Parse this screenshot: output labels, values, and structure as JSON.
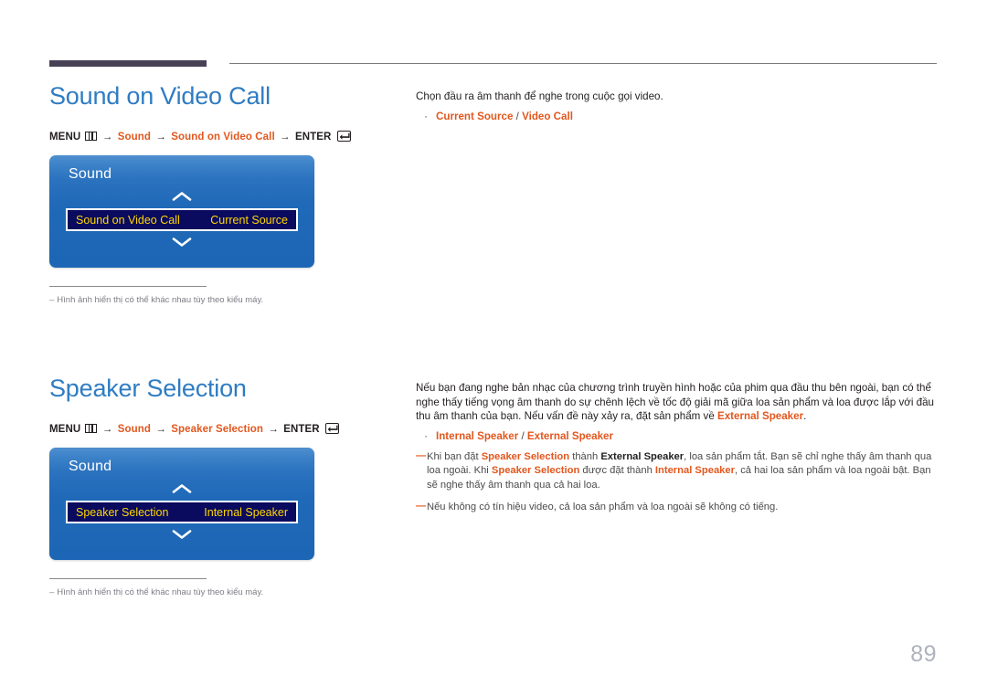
{
  "page": {
    "number": "89"
  },
  "sections": [
    {
      "heading": "Sound on Video Call",
      "menupath": {
        "menu_label": "MENU",
        "arrow": "→",
        "step1": "Sound",
        "step2": "Sound on Video Call",
        "enter_label": "ENTER"
      },
      "tv": {
        "title": "Sound",
        "row_label": "Sound on Video Call",
        "row_value": "Current Source",
        "chevron_up": "chevron-up-icon",
        "chevron_down": "chevron-down-icon"
      },
      "footnote": {
        "dash": "–",
        "text": "Hình ảnh hiển thị có thể khác nhau tùy theo kiểu máy."
      },
      "right": {
        "intro": "Chọn đầu ra âm thanh để nghe trong cuộc gọi video.",
        "bullet": {
          "dot": "·",
          "option1": "Current Source",
          "separator": " / ",
          "option2": "Video Call"
        }
      }
    },
    {
      "heading": "Speaker Selection",
      "menupath": {
        "menu_label": "MENU",
        "arrow": "→",
        "step1": "Sound",
        "step2": "Speaker Selection",
        "enter_label": "ENTER"
      },
      "tv": {
        "title": "Sound",
        "row_label": "Speaker Selection",
        "row_value": "Internal Speaker",
        "chevron_up": "chevron-up-icon",
        "chevron_down": "chevron-down-icon"
      },
      "footnote": {
        "dash": "–",
        "text": "Hình ảnh hiển thị có thể khác nhau tùy theo kiểu máy."
      },
      "right": {
        "para_part1": "Nếu bạn đang nghe bản nhạc của chương trình truyền hình hoặc của phim qua đầu thu bên ngoài, bạn có thể nghe thấy tiếng vọng âm thanh do sự chênh lệch về tốc độ giải mã giữa loa sản phẩm và loa được lắp với đầu thu âm thanh của bạn. Nếu vấn đề này xảy ra, đặt sản phẩm về ",
        "para_hl1": "External Speaker",
        "para_part2": ".",
        "bullet": {
          "dot": "·",
          "option1": "Internal Speaker",
          "separator": " / ",
          "option2": "External Speaker"
        },
        "notes": [
          {
            "emdash": "—",
            "p1": "Khi bạn đặt ",
            "hl1": "Speaker Selection",
            "p2": " thành ",
            "bk1": "External Speaker",
            "p3": ", loa sản phẩm tắt. Bạn sẽ chỉ nghe thấy âm thanh qua loa ngoài. Khi ",
            "hl2": "Speaker Selection",
            "p4": " được đặt thành ",
            "hl3": "Internal Speaker",
            "p5": ", cả hai loa sản phẩm và loa ngoài bật. Bạn sẽ nghe thấy âm thanh qua cả hai loa."
          },
          {
            "emdash": "—",
            "p1": "Nếu không có tín hiệu video, cả loa sản phẩm và loa ngoài sẽ không có tiếng."
          }
        ]
      }
    }
  ],
  "colors": {
    "heading_blue": "#2f7cc2",
    "accent_orange": "#e2571e",
    "menu_blue": "#1f69b8",
    "menu_row_navy": "#0a0a5e",
    "menu_row_gold": "#ffd700",
    "page_number_gray": "#aeb3bd"
  }
}
